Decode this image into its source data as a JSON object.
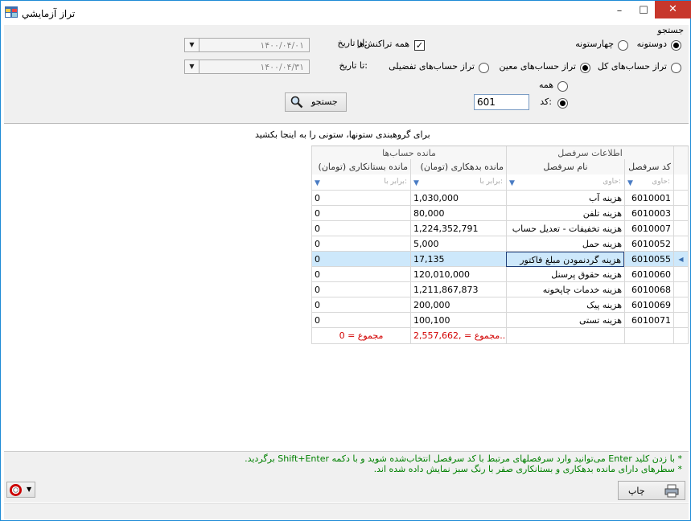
{
  "window": {
    "title": "تراز آزمايشي",
    "min_glyph": "–",
    "max_glyph": "☐",
    "close_glyph": "✕"
  },
  "search": {
    "group_label": "جستجو",
    "two_col_label": "دوستونه",
    "four_col_label": "چهارستونه",
    "all_tx_label": "همه تراکنش‌ها",
    "from_label": "از تاریخ:",
    "to_label": "تا تاریخ:",
    "from_date": "۱۴۰۰/۰۴/۰۱",
    "to_date": "۱۴۰۰/۰۴/۳۱",
    "total_acc_label": "تراز حساب‌های کل",
    "specific_acc_label": "تراز حساب‌های معین",
    "detail_acc_label": "تراز حساب‌های تفضیلی",
    "all_label": "همه",
    "code_label": "کد:",
    "code_value": "601",
    "search_button": "جستجو"
  },
  "group_hint": "برای گروهبندی ستونها، ستونی را به اینجا بکشید",
  "grid": {
    "band_account_info": "اطلاعات سرفصل",
    "band_balances": "مانده حساب‌ها",
    "col_code": "کد سرفصل",
    "col_name": "نام سرفصل",
    "col_debit": "مانده بدهکاری (تومان)",
    "col_credit": "مانده بستانکاری (تومان)",
    "filter_contains": "حاوی:",
    "filter_equals": "برابر با:",
    "rows": [
      {
        "code": "6010001",
        "name": "هزینه آب",
        "debit": "1,030,000",
        "credit": "0"
      },
      {
        "code": "6010003",
        "name": "هزینه تلفن",
        "debit": "80,000",
        "credit": "0"
      },
      {
        "code": "6010007",
        "name": "هزینه تخفیفات - تعدیل حساب",
        "debit": "1,224,352,791",
        "credit": "0"
      },
      {
        "code": "6010052",
        "name": "هزینه حمل",
        "debit": "5,000",
        "credit": "0"
      },
      {
        "code": "6010055",
        "name": "هزینه گردنمودن مبلغ فاکتور",
        "debit": "17,135",
        "credit": "0"
      },
      {
        "code": "6010060",
        "name": "هزینه حقوق پرسنل",
        "debit": "120,010,000",
        "credit": "0"
      },
      {
        "code": "6010068",
        "name": "هزینه خدمات چاپخونه",
        "debit": "1,211,867,873",
        "credit": "0"
      },
      {
        "code": "6010069",
        "name": "هزینه پیک",
        "debit": "200,000",
        "credit": "0"
      },
      {
        "code": "6010071",
        "name": "هزینه تستی",
        "debit": "100,100",
        "credit": "0"
      }
    ],
    "sum_debit": "مجموع = ,2,557,662...",
    "sum_credit": "مجموع = 0"
  },
  "notes": {
    "line1": "* با زدن کلید Enter می‌توانید وارد سرفصلهای مرتبط با کد سرفصل انتخاب‌شده شوید و با دکمه Shift+Enter برگردید.",
    "line2": "* سطرهای دارای مانده بدهکاری و بستانکاری صفر با رنگ سبز نمایش داده شده اند."
  },
  "print_button": "چاپ",
  "colors": {
    "accent": "#1e8bd6",
    "close": "#c7372c",
    "note_green": "#008000",
    "sum_red": "#d20000",
    "selected_row": "#cde8fb"
  }
}
